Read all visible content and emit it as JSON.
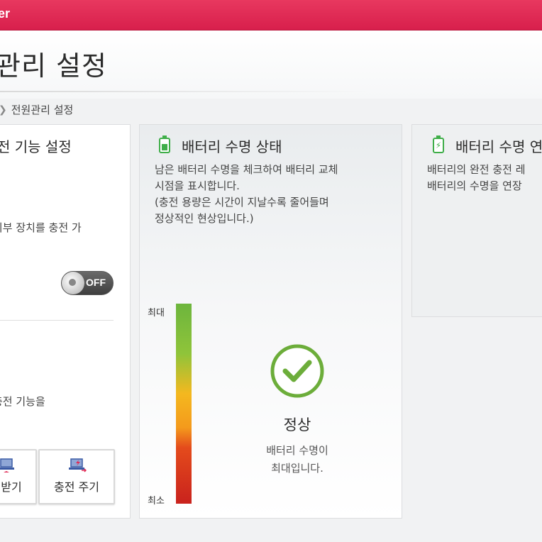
{
  "window": {
    "title": "er"
  },
  "header": {
    "page_title": "관리 설정"
  },
  "breadcrumb": {
    "current": "전원관리 설정"
  },
  "left_panel": {
    "title": "전 기능 설정",
    "desc1": "외부 장치를 충전 가",
    "toggle_state": "OFF",
    "desc2": "충전 기능을",
    "buttons": [
      {
        "label": "받기"
      },
      {
        "label": "충전 주기"
      }
    ]
  },
  "battery_life": {
    "title": "배터리 수명 상태",
    "description": "남은 배터리 수명을 체크하여 배터리 교체\n시점을 표시합니다.\n(충전 용량은 시간이 지날수록 줄어들며\n정상적인 현상입니다.)",
    "gauge_max_label": "최대",
    "gauge_min_label": "최소",
    "status": "정상",
    "status_desc_line1": "배터리 수명이",
    "status_desc_line2": "최대입니다."
  },
  "right_panel": {
    "title": "배터리 수명 연",
    "description": "배터리의 완전 충전 레\n배터리의 수명을 연장"
  },
  "colors": {
    "accent": "#e02a55",
    "ok_green": "#3fae49"
  },
  "icons": {
    "battery": "battery-icon",
    "battery_charge": "battery-charging-icon",
    "ok": "checkmark-circle-icon"
  }
}
